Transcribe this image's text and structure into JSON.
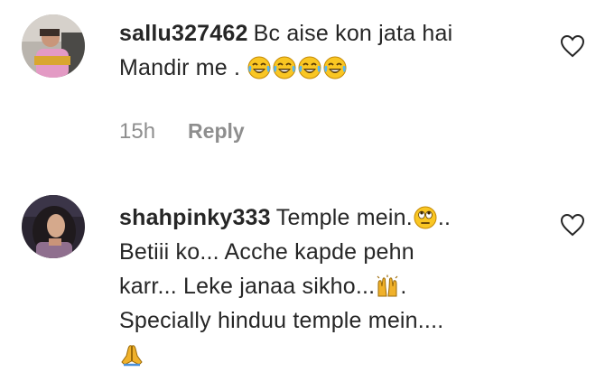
{
  "comments": [
    {
      "username": "sallu327462",
      "text_line1": "Bc aise kon jata hai",
      "text_line2": "Mandir me .",
      "emojis": [
        "face-with-tears-of-joy",
        "face-with-tears-of-joy",
        "face-with-tears-of-joy",
        "face-with-tears-of-joy"
      ],
      "time": "15h",
      "reply_label": "Reply"
    },
    {
      "username": "shahpinky333",
      "seg1": "Temple mein.",
      "seg2": "..",
      "line2": "Betiii ko... Acche kapde pehn",
      "line3a": "karr... Leke janaa sikho...",
      "line3b": ".",
      "line4": "Specially hinduu temple mein....",
      "emojis": [
        "face-with-rolling-eyes",
        "raising-hands",
        "folded-hands"
      ]
    }
  ],
  "colors": {
    "text": "#262626",
    "secondary": "#8e8e8e",
    "emoji_yellow": "#f9c623"
  },
  "icons": [
    "heart-icon",
    "heart-icon"
  ]
}
